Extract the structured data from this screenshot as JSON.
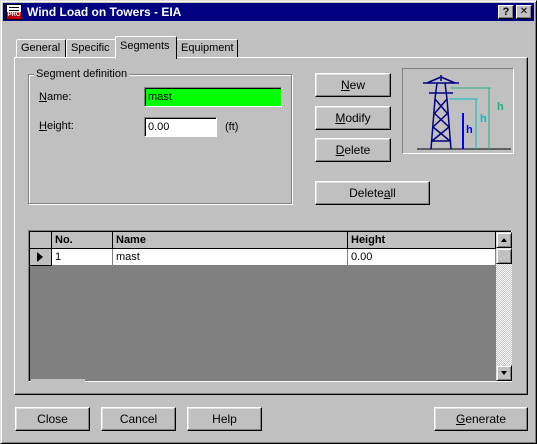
{
  "window": {
    "title": "Wind Load on Towers - EIA",
    "help_button": "?",
    "close_button": "✕"
  },
  "tabs": [
    {
      "label": "General",
      "active": false
    },
    {
      "label": "Specific",
      "active": false
    },
    {
      "label": "Segments",
      "active": true
    },
    {
      "label": "Equipment",
      "active": false
    }
  ],
  "segment_definition": {
    "legend": "Segment definition",
    "name_label_u": "N",
    "name_label_rest": "ame:",
    "name_value": "mast",
    "name_bg": "#00ff00",
    "height_label_u": "H",
    "height_label_rest": "eight:",
    "height_value": "0.00",
    "height_unit": "(ft)"
  },
  "actions": {
    "new_u": "N",
    "new_rest": "ew",
    "modify_u": "M",
    "modify_rest": "odify",
    "delete_u": "D",
    "delete_rest": "elete",
    "delete_all_pre": "Delete ",
    "delete_all_u": "a",
    "delete_all_rest": "ll"
  },
  "preview": {
    "h_label": "h",
    "colors": {
      "tower": "#000080",
      "dim": "#00c0c0",
      "dim_outer": "#20b080",
      "bar": "#0000ff"
    }
  },
  "table": {
    "columns": [
      "No.",
      "Name",
      "Height"
    ],
    "rows": [
      {
        "no": "1",
        "name": "mast",
        "height": "0.00"
      }
    ]
  },
  "footer": {
    "close": "Close",
    "cancel": "Cancel",
    "help": "Help",
    "generate_u": "G",
    "generate_rest": "enerate"
  }
}
